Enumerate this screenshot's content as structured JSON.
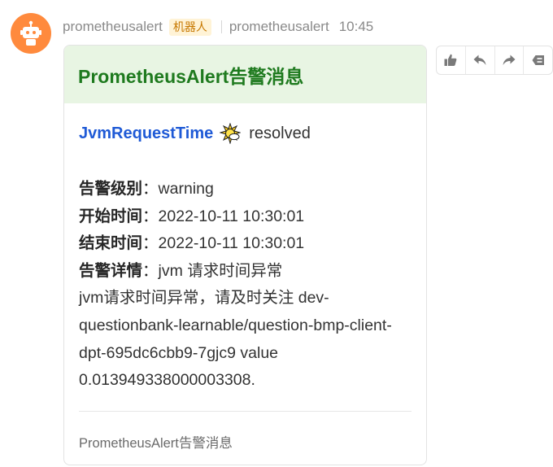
{
  "sender": {
    "name": "prometheusalert",
    "badge": "机器人",
    "display_name": "prometheusalert",
    "time": "10:45"
  },
  "card": {
    "title": "PrometheusAlert告警消息",
    "alert_name": "JvmRequestTime",
    "status": "resolved",
    "fields": [
      {
        "key": "告警级别",
        "colon": "：",
        "value": "warning"
      },
      {
        "key": "开始时间",
        "colon": "：",
        "value": "2022-10-11 10:30:01"
      },
      {
        "key": "结束时间",
        "colon": "：",
        "value": "2022-10-11 10:30:01"
      },
      {
        "key": "告警详情",
        "colon": "：",
        "value": "jvm 请求时间异常"
      }
    ],
    "description": "jvm请求时间异常，请及时关注 dev-questionbank-learnable/question-bmp-client-dpt-695dc6cbb9-7gjc9  value 0.013949338000003308.",
    "footer": "PrometheusAlert告警消息"
  },
  "actions": [
    {
      "name": "thumbs-up-icon"
    },
    {
      "name": "reply-icon"
    },
    {
      "name": "forward-icon"
    },
    {
      "name": "more-icon"
    }
  ],
  "colors": {
    "avatar": "#ff8a3d",
    "header_bg": "#e8f5e3",
    "title": "#1e7a1e",
    "alert_name": "#1f5ad6",
    "badge_bg": "#fff3d6",
    "badge_text": "#c77800"
  }
}
